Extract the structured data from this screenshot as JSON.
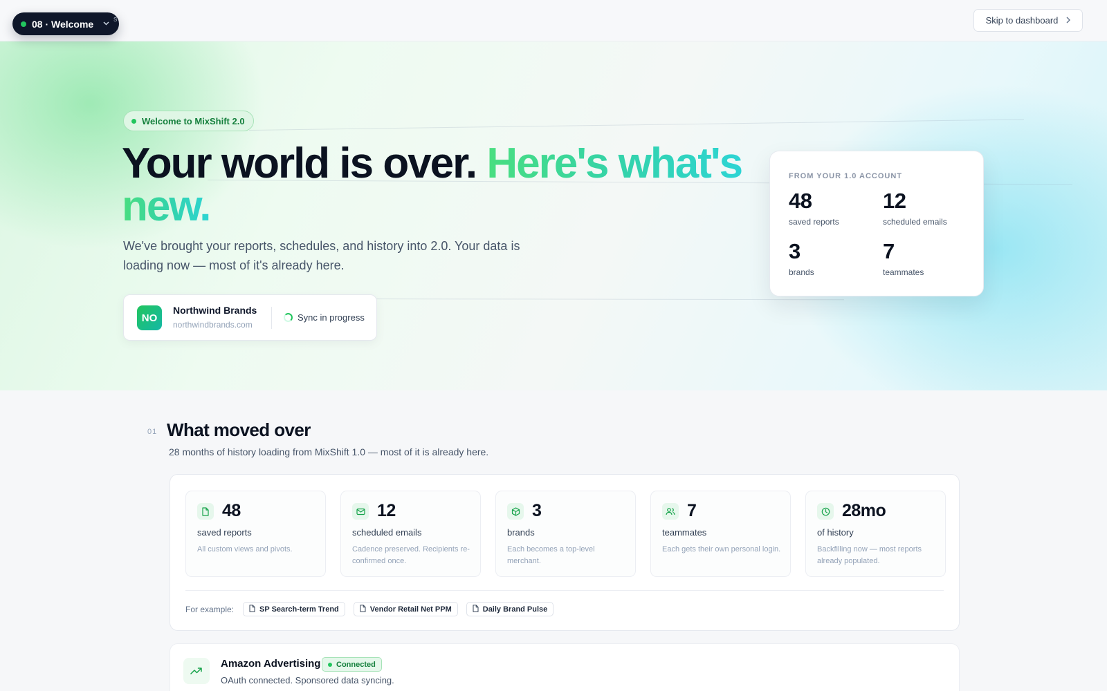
{
  "topbar": {
    "step_label": "08 · Welcome",
    "ghost_char": "s",
    "skip_label": "Skip to dashboard"
  },
  "hero": {
    "badge": "Welcome to MixShift 2.0",
    "title_dark": "Your world is over.",
    "title_accent_1": "Here's what's",
    "title_accent_2": "new.",
    "subtitle": "We've brought your reports, schedules, and history into 2.0. Your data is loading now — most of it's already here.",
    "org": {
      "initials": "NO",
      "name": "Northwind Brands",
      "domain": "northwindbrands.com",
      "sync_status": "Sync in progress"
    },
    "account_card": {
      "eyebrow": "FROM YOUR 1.0 ACCOUNT",
      "stats": [
        {
          "value": "48",
          "label": "saved reports"
        },
        {
          "value": "12",
          "label": "scheduled emails"
        },
        {
          "value": "3",
          "label": "brands"
        },
        {
          "value": "7",
          "label": "teammates"
        }
      ]
    }
  },
  "section": {
    "number": "01",
    "title": "What moved over",
    "subtitle": "28 months of history loading from MixShift 1.0 — most of it is already here.",
    "cards": [
      {
        "icon": "file-icon",
        "value": "48",
        "label": "saved reports",
        "desc": "All custom views and pivots."
      },
      {
        "icon": "mail-icon",
        "value": "12",
        "label": "scheduled emails",
        "desc": "Cadence preserved. Recipients re-confirmed once."
      },
      {
        "icon": "box-icon",
        "value": "3",
        "label": "brands",
        "desc": "Each becomes a top-level merchant."
      },
      {
        "icon": "users-icon",
        "value": "7",
        "label": "teammates",
        "desc": "Each gets their own personal login."
      },
      {
        "icon": "clock-icon",
        "value": "28mo",
        "label": "of history",
        "desc": "Backfilling now — most reports already populated."
      }
    ],
    "examples_label": "For example:",
    "examples": [
      "SP Search-term Trend",
      "Vendor Retail Net PPM",
      "Daily Brand Pulse"
    ]
  },
  "integration": {
    "icon": "trend-up-icon",
    "name": "Amazon Advertising",
    "status": "Connected",
    "description": "OAuth connected. Sponsored data syncing."
  },
  "colors": {
    "accent_green": "#22c55e",
    "accent_teal": "#2dd4d4",
    "ink": "#0b1220"
  }
}
